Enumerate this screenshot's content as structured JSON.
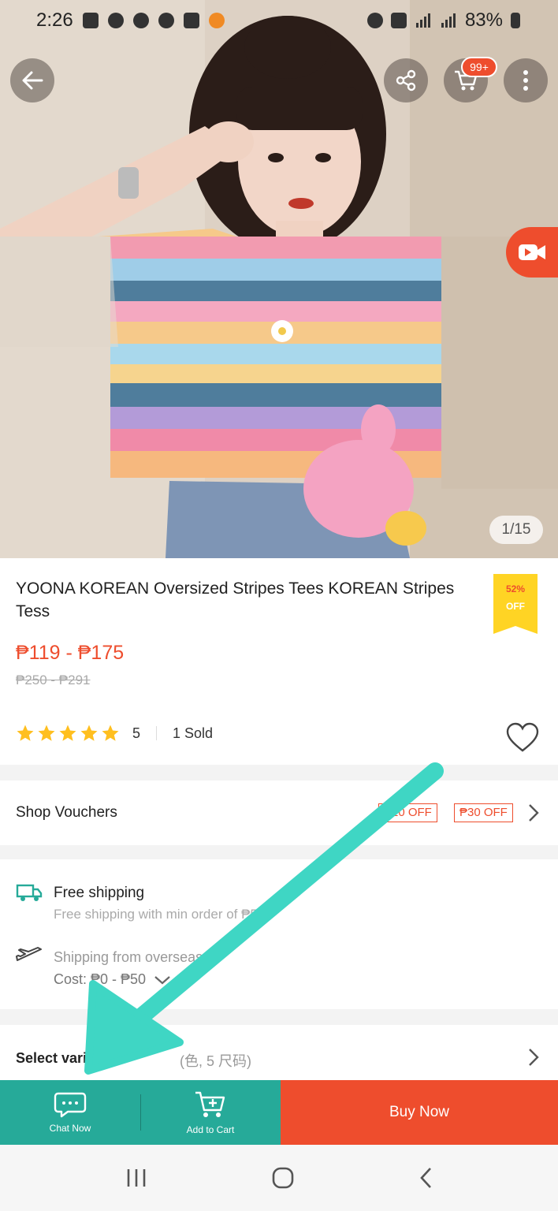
{
  "status_bar": {
    "time": "2:26",
    "battery": "83%"
  },
  "top_bar": {
    "cart_badge": "99+"
  },
  "gallery": {
    "counter": "1/15"
  },
  "product": {
    "title": "YOONA KOREAN Oversized Stripes Tees KOREAN Stripes Tess",
    "discount_pct": "52%",
    "discount_off": "OFF",
    "price_range": "₱119 - ₱175",
    "original_price": "₱250 - ₱291",
    "rating": "5",
    "stars": 5,
    "sold": "1 Sold"
  },
  "vouchers": {
    "label": "Shop Vouchers",
    "chips": [
      "₱20 OFF",
      "₱30 OFF"
    ]
  },
  "shipping": {
    "free_title": "Free shipping",
    "free_sub": "Free shipping with min order of ₱500",
    "overseas_title": "Shipping from overseas",
    "overseas_cost": "Cost: ₱0 - ₱50"
  },
  "variation": {
    "label": "Select variation",
    "sub": "(色, 5 尺码)"
  },
  "actions": {
    "chat_label": "Chat Now",
    "cart_label": "Add to Cart",
    "buy_label": "Buy Now"
  },
  "colors": {
    "brand": "#ee4d2d",
    "teal": "#26aa99",
    "badge_yellow": "#ffd424",
    "arrow": "#3fd6c4"
  }
}
